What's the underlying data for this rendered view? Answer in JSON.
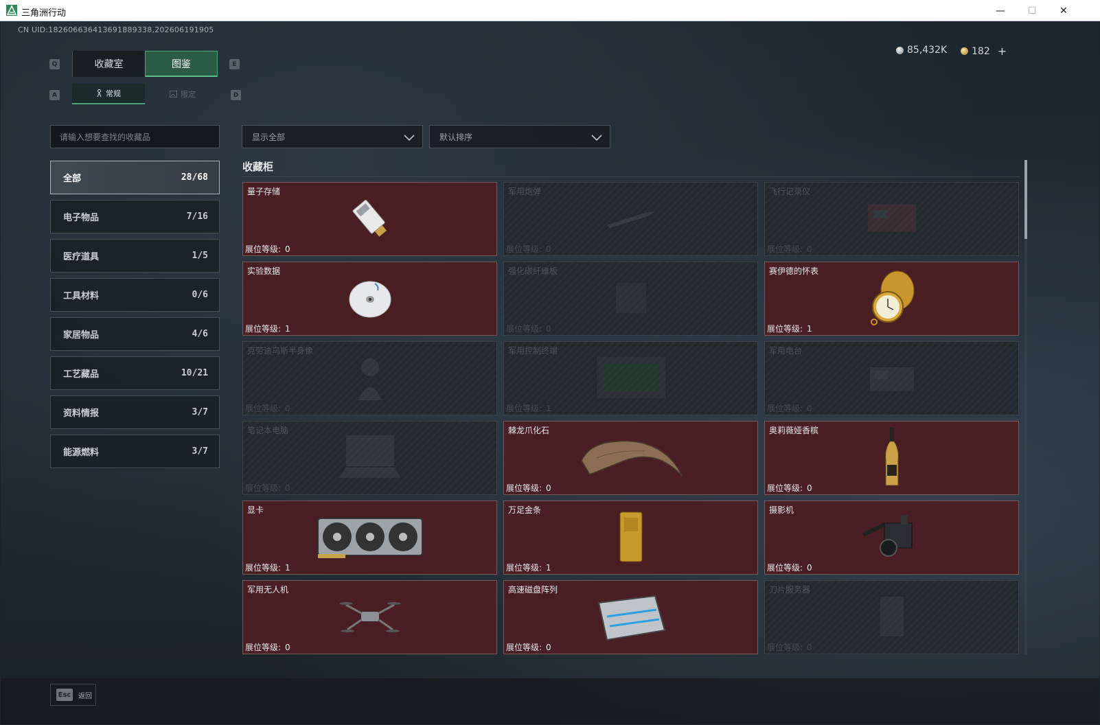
{
  "window": {
    "title": "三角洲行动",
    "minimize": "—",
    "maximize": "☐",
    "close": "✕"
  },
  "header": {
    "uid": "CN UID:182606636413691889338,202606191905",
    "currency_silver": "85,432K",
    "currency_gold": "182",
    "plus": "+"
  },
  "key_hints": {
    "q": "Q",
    "e": "E",
    "a": "A",
    "d": "D"
  },
  "tabs": [
    {
      "label": "收藏室",
      "active": false
    },
    {
      "label": "图鉴",
      "active": true
    }
  ],
  "subtabs": [
    {
      "label": "常规",
      "active": true
    },
    {
      "label": "限定",
      "active": false
    }
  ],
  "search": {
    "placeholder": "请输入想要查找的收藏品"
  },
  "filters": {
    "display": "显示全部",
    "sort": "默认排序"
  },
  "categories": [
    {
      "label": "全部",
      "count": "28/68",
      "active": true
    },
    {
      "label": "电子物品",
      "count": "7/16"
    },
    {
      "label": "医疗道具",
      "count": "1/5"
    },
    {
      "label": "工具材料",
      "count": "0/6"
    },
    {
      "label": "家居物品",
      "count": "4/6"
    },
    {
      "label": "工艺藏品",
      "count": "10/21"
    },
    {
      "label": "资料情报",
      "count": "3/7"
    },
    {
      "label": "能源燃料",
      "count": "3/7"
    }
  ],
  "section": {
    "title": "收藏柜"
  },
  "level_label": "展位等级:",
  "items": [
    {
      "name": "量子存储",
      "level": "0",
      "owned": true,
      "icon": "usb-drive"
    },
    {
      "name": "军用炮弹",
      "level": "0",
      "owned": false,
      "icon": "shell"
    },
    {
      "name": "飞行记录仪",
      "level": "0",
      "owned": false,
      "icon": "flight-recorder"
    },
    {
      "name": "实验数据",
      "level": "1",
      "owned": true,
      "icon": "disc"
    },
    {
      "name": "强化碳纤维板",
      "level": "0",
      "owned": false,
      "icon": "carbon-plate"
    },
    {
      "name": "赛伊德的怀表",
      "level": "1",
      "owned": true,
      "icon": "pocket-watch"
    },
    {
      "name": "克劳迪乌斯半身像",
      "level": "0",
      "owned": false,
      "icon": "bust"
    },
    {
      "name": "军用控制终端",
      "level": "1",
      "owned": false,
      "icon": "terminal"
    },
    {
      "name": "军用电台",
      "level": "0",
      "owned": false,
      "icon": "radio"
    },
    {
      "name": "笔记本电脑",
      "level": "0",
      "owned": false,
      "icon": "laptop"
    },
    {
      "name": "棘龙爪化石",
      "level": "0",
      "owned": true,
      "icon": "claw-fossil"
    },
    {
      "name": "奥莉薇娅香槟",
      "level": "0",
      "owned": true,
      "icon": "champagne"
    },
    {
      "name": "显卡",
      "level": "1",
      "owned": true,
      "icon": "gpu"
    },
    {
      "name": "万足金条",
      "level": "1",
      "owned": true,
      "icon": "gold-bar"
    },
    {
      "name": "摄影机",
      "level": "0",
      "owned": true,
      "icon": "camera"
    },
    {
      "name": "军用无人机",
      "level": "0",
      "owned": true,
      "icon": "drone"
    },
    {
      "name": "高速磁盘阵列",
      "level": "0",
      "owned": true,
      "icon": "disk-array"
    },
    {
      "name": "刀片服务器",
      "level": "0",
      "owned": false,
      "icon": "blade-server"
    }
  ],
  "footer": {
    "esc_key": "Esc",
    "esc_label": "返回"
  }
}
